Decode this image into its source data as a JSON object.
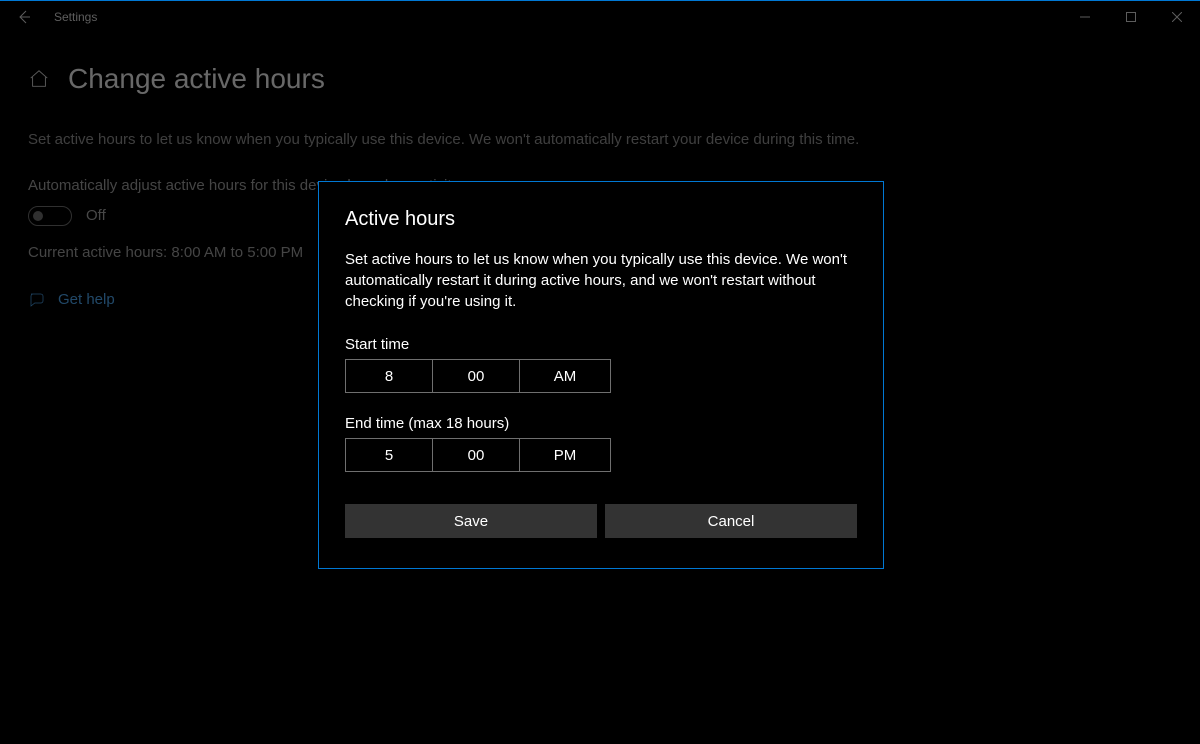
{
  "titlebar": {
    "title": "Settings"
  },
  "page": {
    "heading": "Change active hours",
    "description": "Set active hours to let us know when you typically use this device. We won't automatically restart your device during this time.",
    "auto_adjust_label": "Automatically adjust active hours for this device based on activity",
    "toggle_state": "Off",
    "current_hours": "Current active hours: 8:00 AM to 5:00 PM",
    "help_label": "Get help"
  },
  "dialog": {
    "title": "Active hours",
    "body": "Set active hours to let us know when you typically use this device. We won't automatically restart it during active hours, and we won't restart without checking if you're using it.",
    "start_label": "Start time",
    "end_label": "End time (max 18 hours)",
    "start": {
      "hour": "8",
      "minute": "00",
      "ampm": "AM"
    },
    "end": {
      "hour": "5",
      "minute": "00",
      "ampm": "PM"
    },
    "save_label": "Save",
    "cancel_label": "Cancel"
  }
}
